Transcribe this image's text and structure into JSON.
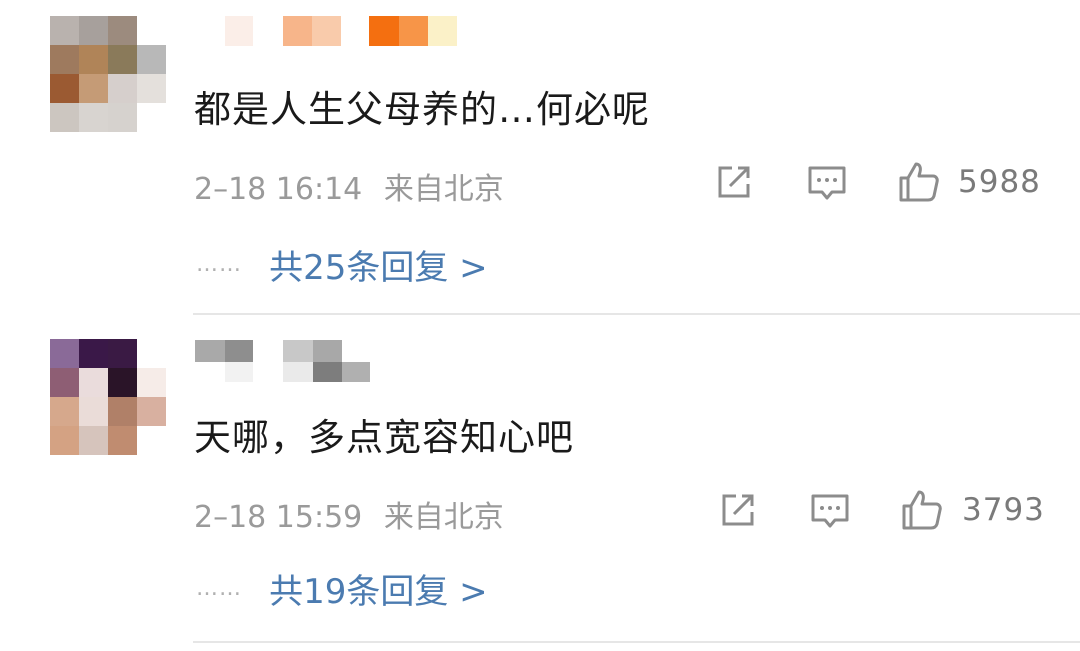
{
  "comments": [
    {
      "text": "都是人生父母养的…何必呢",
      "time": "2–18 16:14",
      "location": "来自北京",
      "likes": "5988",
      "replies_label": "共25条回复 >",
      "dots": "……"
    },
    {
      "text": "天哪，多点宽容知心吧",
      "time": "2–18 15:59",
      "location": "来自北京",
      "likes": "3793",
      "replies_label": "共19条回复 >",
      "dots": "……"
    }
  ],
  "colors": {
    "link": "#4b7bb0",
    "meta": "#9a9a9a",
    "divider": "#e6e6e6"
  },
  "icons": [
    "share-icon",
    "comment-icon",
    "thumbs-up-icon"
  ]
}
